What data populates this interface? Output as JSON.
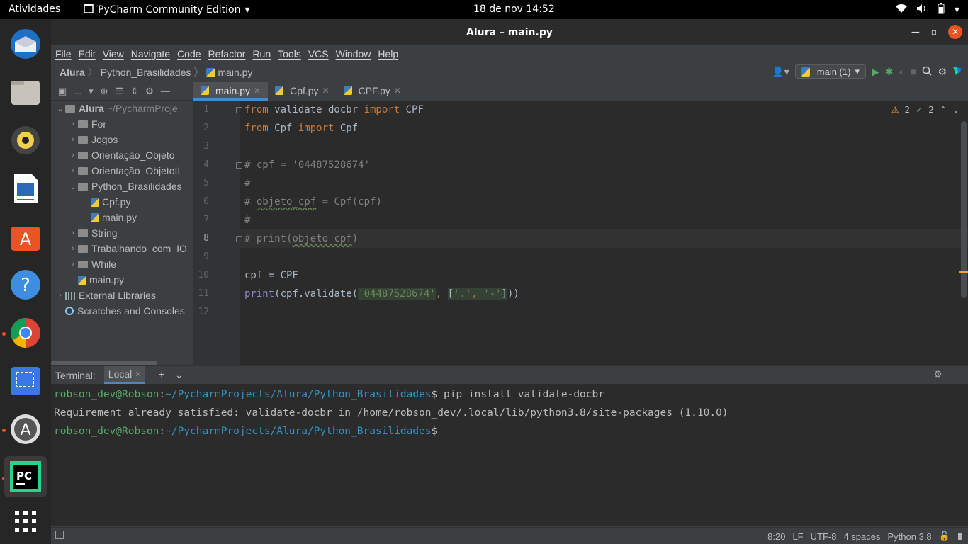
{
  "topbar": {
    "activities": "Atividades",
    "app_name": "PyCharm Community Edition",
    "clock": "18 de nov  14:52"
  },
  "dock": {
    "items": [
      {
        "name": "thunderbird-icon",
        "color": "#1f6fc7"
      },
      {
        "name": "files-icon",
        "color": "#c7c3bb"
      },
      {
        "name": "rhythmbox-icon",
        "color": "#f3d04b"
      },
      {
        "name": "libreoffice-writer-icon",
        "color": "#2b6ab8"
      },
      {
        "name": "software-center-icon",
        "color": "#e95420"
      },
      {
        "name": "help-icon",
        "color": "#3d8ee0"
      },
      {
        "name": "chrome-icon",
        "color": "#db4437"
      },
      {
        "name": "screenshot-icon",
        "color": "#3b78e7"
      },
      {
        "name": "app-updater-icon",
        "color": "#9a9a9a"
      },
      {
        "name": "pycharm-icon",
        "color": "#21d789"
      },
      {
        "name": "show-apps-icon",
        "color": "#ffffff"
      }
    ]
  },
  "window": {
    "title": "Alura – main.py",
    "menu": [
      "File",
      "Edit",
      "View",
      "Navigate",
      "Code",
      "Refactor",
      "Run",
      "Tools",
      "VCS",
      "Window",
      "Help"
    ],
    "breadcrumb": [
      "Alura",
      "Python_Brasilidades",
      "main.py"
    ],
    "run_config": "main (1)"
  },
  "project": {
    "toolbar_label": "...",
    "root": {
      "name": "Alura",
      "path": "~/PycharmProje"
    },
    "items": [
      {
        "label": "For",
        "type": "folder",
        "expanded": false,
        "indent": 1
      },
      {
        "label": "Jogos",
        "type": "folder",
        "expanded": false,
        "indent": 1
      },
      {
        "label": "Orientação_Objeto",
        "type": "folder",
        "expanded": false,
        "indent": 1
      },
      {
        "label": "Orientação_ObjetoII",
        "type": "folder",
        "expanded": false,
        "indent": 1
      },
      {
        "label": "Python_Brasilidades",
        "type": "folder",
        "expanded": true,
        "indent": 1
      },
      {
        "label": "Cpf.py",
        "type": "py",
        "indent": 2
      },
      {
        "label": "main.py",
        "type": "py",
        "indent": 2
      },
      {
        "label": "String",
        "type": "folder",
        "expanded": false,
        "indent": 1
      },
      {
        "label": "Trabalhando_com_IO",
        "type": "folder",
        "expanded": false,
        "indent": 1
      },
      {
        "label": "While",
        "type": "folder",
        "expanded": false,
        "indent": 1
      },
      {
        "label": "main.py",
        "type": "py",
        "indent": 1
      }
    ],
    "external_libraries": "External Libraries",
    "scratches": "Scratches and Consoles"
  },
  "editor": {
    "tabs": [
      {
        "label": "main.py",
        "active": true
      },
      {
        "label": "Cpf.py",
        "active": false
      },
      {
        "label": "CPF.py",
        "active": false
      }
    ],
    "inspections": {
      "warnings": "2",
      "weak_warnings": "2"
    },
    "line_numbers": [
      "1",
      "2",
      "3",
      "4",
      "5",
      "6",
      "7",
      "8",
      "9",
      "10",
      "11",
      "12"
    ],
    "current_line": 8
  },
  "terminal": {
    "label": "Terminal:",
    "tab": "Local",
    "lines": [
      {
        "user": "robson_dev@Robson",
        "path": "~/PycharmProjects/Alura/Python_Brasilidades",
        "cmd": " pip install validate-docbr"
      },
      {
        "output": "Requirement already satisfied: validate-docbr in /home/robson_dev/.local/lib/python3.8/site-packages (1.10.0)"
      },
      {
        "user": "robson_dev@Robson",
        "path": "~/PycharmProjects/Alura/Python_Brasilidades",
        "cmd": ""
      }
    ]
  },
  "status": {
    "position": "8:20",
    "line_sep": "LF",
    "encoding": "UTF-8",
    "indent": "4 spaces",
    "interpreter": "Python 3.8"
  }
}
